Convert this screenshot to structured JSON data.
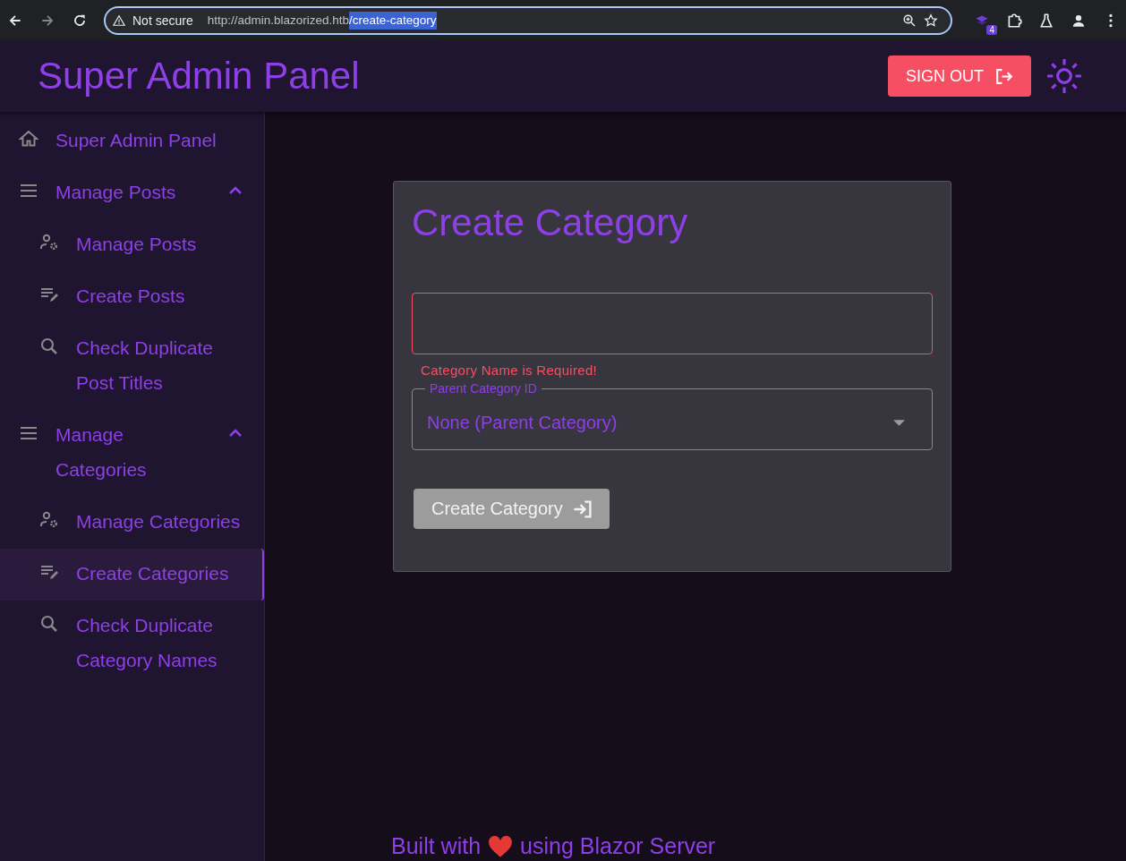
{
  "browser": {
    "security": "Not secure",
    "url_host": "http://admin.blazorized.htb",
    "url_path": "/create-category",
    "extension_badge": "4"
  },
  "header": {
    "title": "Super Admin Panel",
    "sign_out": "SIGN OUT"
  },
  "sidebar": {
    "items": [
      {
        "kind": "link",
        "label": "Super Admin Panel",
        "selected": false
      },
      {
        "kind": "group",
        "label": "Manage Posts",
        "expanded": true,
        "children": [
          {
            "label": "Manage Posts",
            "selected": false
          },
          {
            "label": "Create Posts",
            "selected": false
          },
          {
            "label": "Check Duplicate Post Titles",
            "selected": false
          }
        ]
      },
      {
        "kind": "group",
        "label": "Manage Categories",
        "expanded": true,
        "children": [
          {
            "label": "Manage Categories",
            "selected": false
          },
          {
            "label": "Create Categories",
            "selected": true
          },
          {
            "label": "Check Duplicate Category Names",
            "selected": false
          }
        ]
      }
    ]
  },
  "form": {
    "title": "Create Category",
    "name_field": {
      "invalid": true
    },
    "error_message": "Category Name is Required!",
    "parent_select": {
      "label": "Parent Category ID",
      "value": "None (Parent Category)"
    },
    "submit": {
      "label": "Create Category",
      "disabled": true
    }
  },
  "footer": {
    "before": "Built with",
    "after": "using Blazor Server"
  }
}
